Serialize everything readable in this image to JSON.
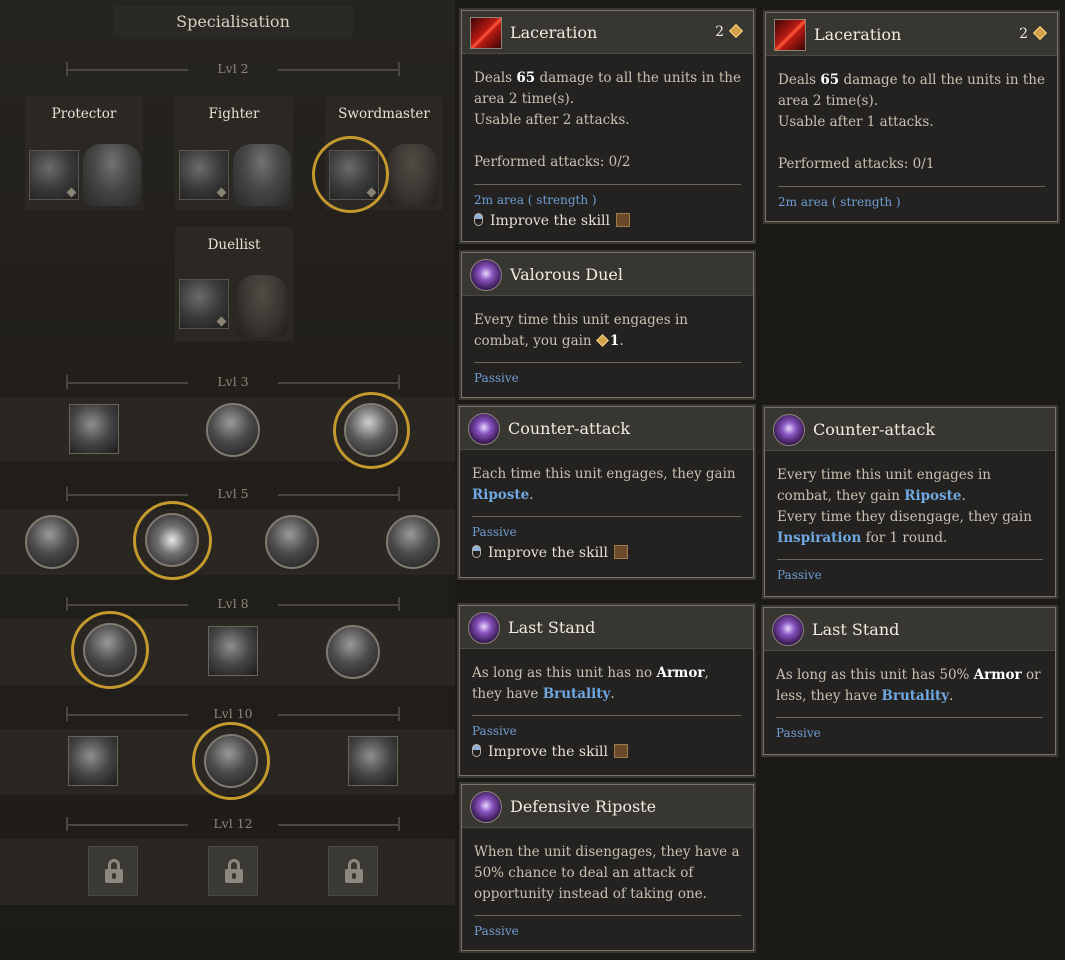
{
  "panel": {
    "title": "Specialisation",
    "levels": [
      "Lvl 2",
      "Lvl 3",
      "Lvl 5",
      "Lvl 8",
      "Lvl 10",
      "Lvl 12"
    ],
    "specs": [
      {
        "name": "Protector",
        "icon": "protector-icon",
        "armor": "plate-armor-icon",
        "selected": false
      },
      {
        "name": "Fighter",
        "icon": "fighter-icon",
        "armor": "plate-armor-icon",
        "selected": false
      },
      {
        "name": "Swordmaster",
        "icon": "swordmaster-icon",
        "armor": "cloth-armor-icon",
        "selected": true
      },
      {
        "name": "Duellist",
        "icon": "duellist-icon",
        "armor": "cloth-armor-icon",
        "selected": false
      }
    ]
  },
  "tooltips": {
    "laceration_a": {
      "title": "Laceration",
      "cost": "2",
      "line1_pre": "Deals ",
      "damage": "65",
      "line1_post": " damage to all the units in the area 2 time(s).",
      "line2": "Usable after 2 attacks.",
      "line3": "Performed attacks: 0/2",
      "footer": "2m area ( strength )",
      "improve": "Improve the skill"
    },
    "laceration_b": {
      "title": "Laceration",
      "cost": "2",
      "line1_pre": "Deals ",
      "damage": "65",
      "line1_post": " damage to all the units in the area 2 time(s).",
      "line2": "Usable after 1 attacks.",
      "line3": "Performed attacks: 0/1",
      "footer": "2m area ( strength )"
    },
    "valorous_duel": {
      "title": "Valorous Duel",
      "text_pre": "Every time this unit engages in combat, you gain ",
      "gain": "1",
      "text_post": ".",
      "footer": "Passive"
    },
    "counter_attack_a": {
      "title": "Counter-attack",
      "text_pre": "Each time this unit engages, they gain ",
      "keyword": "Riposte",
      "text_post": ".",
      "footer": "Passive",
      "improve": "Improve the skill"
    },
    "counter_attack_b": {
      "title": "Counter-attack",
      "line1_pre": "Every time this unit engages in combat, they gain ",
      "keyword1": "Riposte",
      "line1_post": ".",
      "line2_pre": "Every time they disengage, they gain ",
      "keyword2": "Inspiration",
      "line2_post": " for 1 round.",
      "footer": "Passive"
    },
    "last_stand_a": {
      "title": "Last Stand",
      "text_pre": "As long as this unit has no ",
      "armor_word": "Armor",
      "text_mid": ", they have ",
      "keyword": "Brutality",
      "text_post": ".",
      "footer": "Passive",
      "improve": "Improve the skill"
    },
    "last_stand_b": {
      "title": "Last Stand",
      "text_pre": "As long as this unit has 50% ",
      "armor_word": "Armor",
      "text_mid": " or less, they have ",
      "keyword": "Brutality",
      "text_post": ".",
      "footer": "Passive"
    },
    "defensive_riposte": {
      "title": "Defensive Riposte",
      "text": "When the unit disengages, they have a 50% chance to deal an attack of opportunity instead of taking one.",
      "footer": "Passive"
    }
  },
  "colors": {
    "selection_ring": "#c49a2e",
    "keyword": "#6fa8e0",
    "passive": "#6f9dd4"
  }
}
